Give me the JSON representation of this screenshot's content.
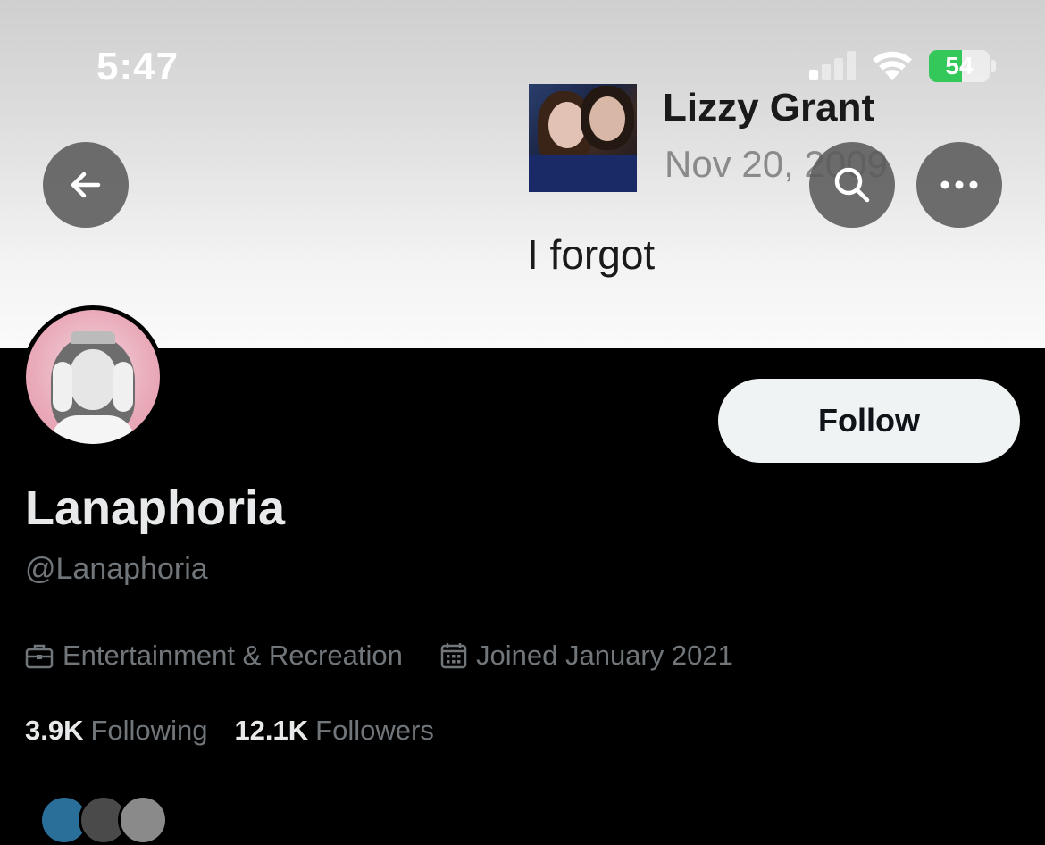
{
  "status_bar": {
    "time": "5:47",
    "battery_level": "54",
    "battery_fraction": 0.54,
    "signal_bars_active": 1,
    "signal_bars_total": 4,
    "icons": [
      "signal-icon",
      "wifi-icon",
      "battery-icon"
    ]
  },
  "banner": {
    "tweet_author": "Lizzy Grant",
    "tweet_date": "Nov 20, 2009",
    "tweet_text": "I forgot"
  },
  "header_buttons": {
    "back_icon": "arrow-left-icon",
    "search_icon": "search-icon",
    "more_icon": "more-horizontal-icon"
  },
  "profile": {
    "follow_label": "Follow",
    "display_name": "Lanaphoria",
    "handle": "@Lanaphoria",
    "category": "Entertainment & Recreation",
    "joined": "Joined January 2021",
    "following_count": "3.9K",
    "following_label": "Following",
    "followers_count": "12.1K",
    "followers_label": "Followers"
  },
  "colors": {
    "background": "#000000",
    "primary_text": "#e7e9ea",
    "secondary_text": "#71767b",
    "follow_button_bg": "#eff3f4",
    "battery_green": "#34c759"
  }
}
